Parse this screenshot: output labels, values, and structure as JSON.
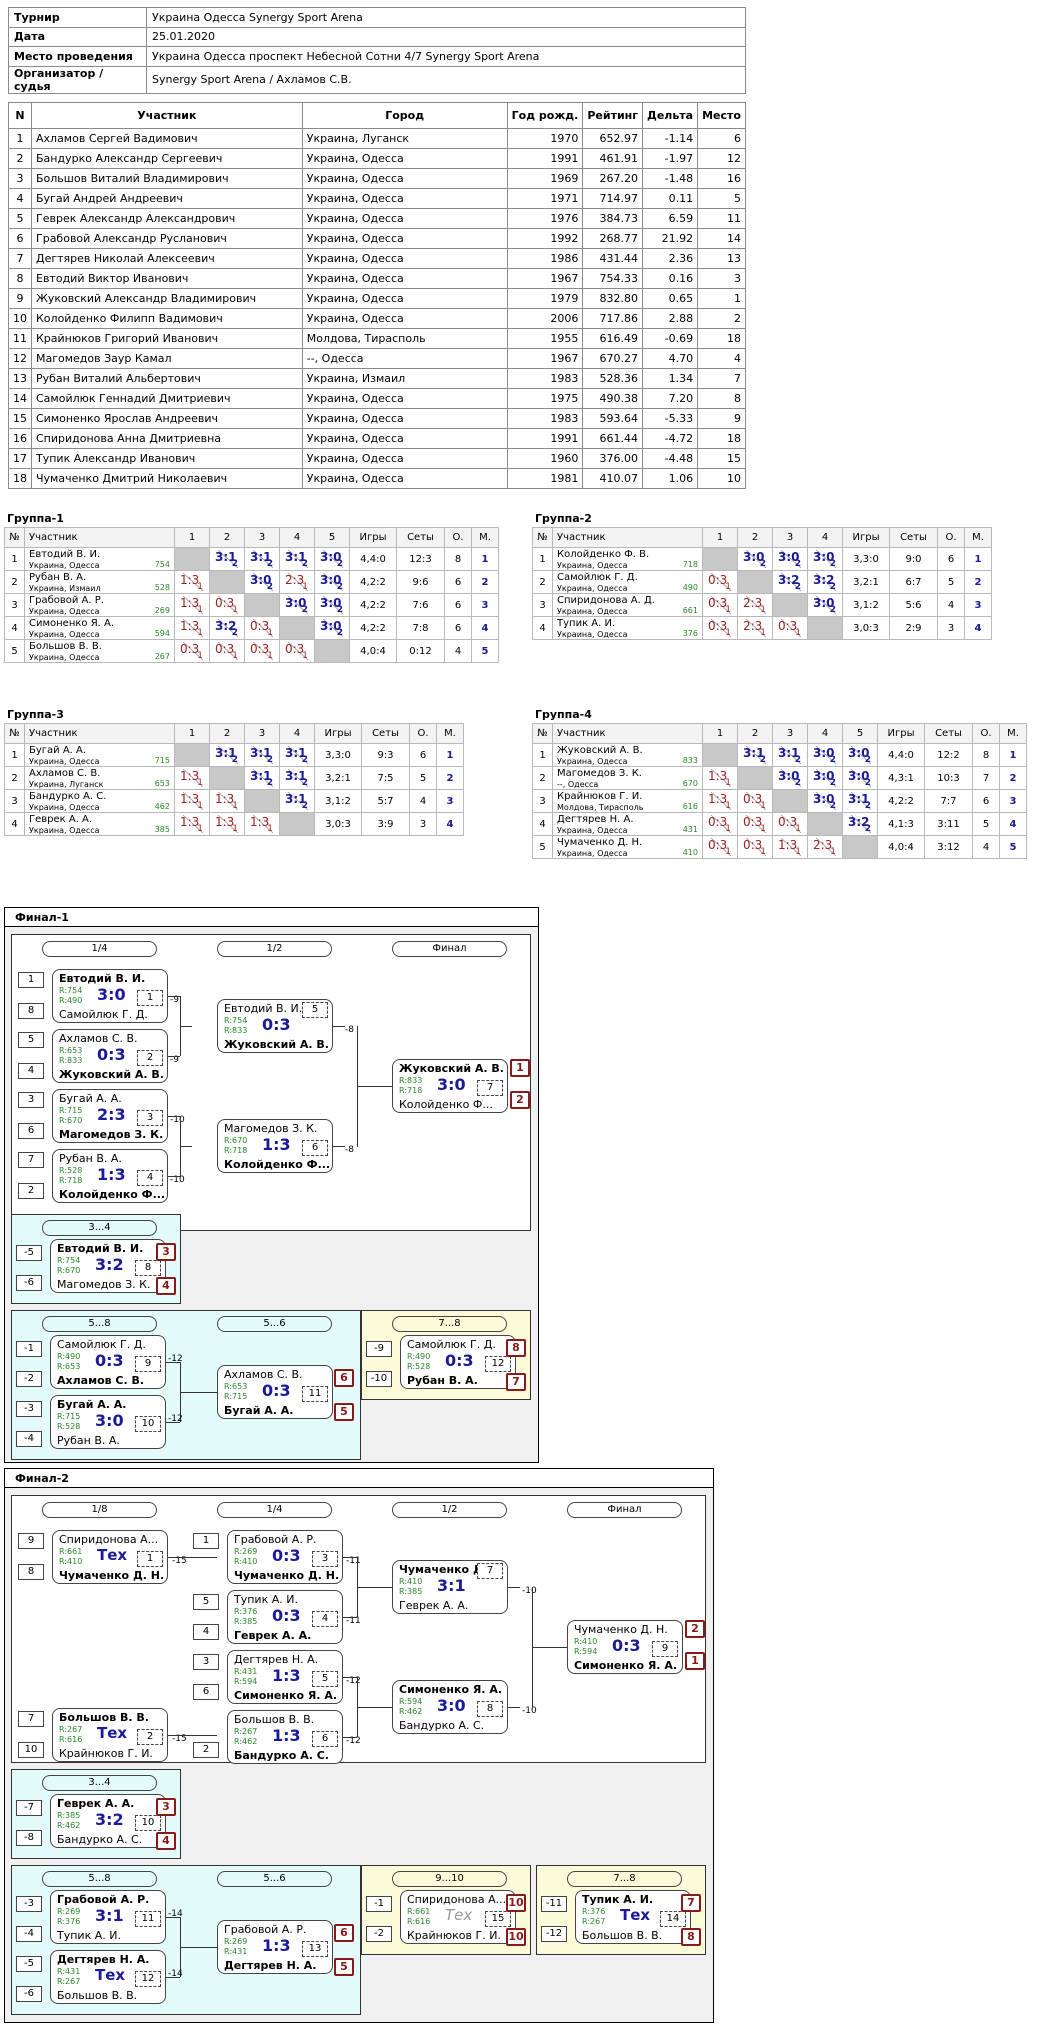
{
  "info": [
    {
      "k": "Турнир",
      "v": "Украина Одесса Synergy Sport Arena"
    },
    {
      "k": "Дата",
      "v": "25.01.2020"
    },
    {
      "k": "Место проведения",
      "v": "Украина Одесса проспект Небесной Сотни 4/7 Synergy Sport Arena"
    },
    {
      "k": "Организатор / судья",
      "v": "Synergy Sport Arena / Ахламов С.В."
    }
  ],
  "players_head": [
    "N",
    "Участник",
    "Город",
    "Год рожд.",
    "Рейтинг",
    "Дельта",
    "Место"
  ],
  "players": [
    [
      "1",
      "Ахламов Сергей Вадимович",
      "Украина, Луганск",
      "1970",
      "652.97",
      "-1.14",
      "6"
    ],
    [
      "2",
      "Бандурко Александр Сергеевич",
      "Украина, Одесса",
      "1991",
      "461.91",
      "-1.97",
      "12"
    ],
    [
      "3",
      "Большов Виталий Владимирович",
      "Украина, Одесса",
      "1969",
      "267.20",
      "-1.48",
      "16"
    ],
    [
      "4",
      "Бугай Андрей Андреевич",
      "Украина, Одесса",
      "1971",
      "714.97",
      "0.11",
      "5"
    ],
    [
      "5",
      "Геврек Александр Александрович",
      "Украина, Одесса",
      "1976",
      "384.73",
      "6.59",
      "11"
    ],
    [
      "6",
      "Грабовой Александр Русланович",
      "Украина, Одесса",
      "1992",
      "268.77",
      "21.92",
      "14"
    ],
    [
      "7",
      "Дегтярев Николай Алексеевич",
      "Украина, Одесса",
      "1986",
      "431.44",
      "2.36",
      "13"
    ],
    [
      "8",
      "Евтодий Виктор Иванович",
      "Украина, Одесса",
      "1967",
      "754.33",
      "0.16",
      "3"
    ],
    [
      "9",
      "Жуковский Александр Владимирович",
      "Украина, Одесса",
      "1979",
      "832.80",
      "0.65",
      "1"
    ],
    [
      "10",
      "Колойденко Филипп Вадимович",
      "Украина, Одесса",
      "2006",
      "717.86",
      "2.88",
      "2"
    ],
    [
      "11",
      "Крайнюков Григорий Иванович",
      "Молдова, Тирасполь",
      "1955",
      "616.49",
      "-0.69",
      "18"
    ],
    [
      "12",
      "Магомедов Заур Камал",
      "--, Одесса",
      "1967",
      "670.27",
      "4.70",
      "4"
    ],
    [
      "13",
      "Рубан Виталий Альбертович",
      "Украина, Измаил",
      "1983",
      "528.36",
      "1.34",
      "7"
    ],
    [
      "14",
      "Самойлюк Геннадий Дмитриевич",
      "Украина, Одесса",
      "1975",
      "490.38",
      "7.20",
      "8"
    ],
    [
      "15",
      "Симоненко Ярослав Андреевич",
      "Украина, Одесса",
      "1983",
      "593.64",
      "-5.33",
      "9"
    ],
    [
      "16",
      "Спиридонова Анна Дмитриевна",
      "Украина, Одесса",
      "1991",
      "661.44",
      "-4.72",
      "18"
    ],
    [
      "17",
      "Тупик Александр Иванович",
      "Украина, Одесса",
      "1960",
      "376.00",
      "-4.48",
      "15"
    ],
    [
      "18",
      "Чумаченко Дмитрий Николаевич",
      "Украина, Одесса",
      "1981",
      "410.07",
      "1.06",
      "10"
    ]
  ],
  "group_head": {
    "n": "№",
    "name": "Участник",
    "games": "Игры",
    "sets": "Сеты",
    "o": "О.",
    "m": "М."
  },
  "groups": [
    {
      "title": "Группа-1",
      "rows": [
        {
          "n": "1",
          "name": "Евтодий В. И.",
          "city": "Украина, Одесса",
          "r": "754",
          "cells": [
            "X",
            "3:1 2",
            "3:1 2",
            "3:1 2",
            "3:0 2"
          ],
          "games": "4,4:0",
          "sets": "12:3",
          "o": "8",
          "m": "1"
        },
        {
          "n": "2",
          "name": "Рубан В. А.",
          "city": "Украина, Измаил",
          "r": "528",
          "cells": [
            "1:3 1",
            "X",
            "3:0 2",
            "2:3 1",
            "3:0 2"
          ],
          "games": "4,2:2",
          "sets": "9:6",
          "o": "6",
          "m": "2"
        },
        {
          "n": "3",
          "name": "Грабовой А. Р.",
          "city": "Украина, Одесса",
          "r": "269",
          "cells": [
            "1:3 1",
            "0:3 1",
            "X",
            "3:0 2",
            "3:0 2"
          ],
          "games": "4,2:2",
          "sets": "7:6",
          "o": "6",
          "m": "3"
        },
        {
          "n": "4",
          "name": "Симоненко Я. А.",
          "city": "Украина, Одесса",
          "r": "594",
          "cells": [
            "1:3 1",
            "3:2 2",
            "0:3 1",
            "X",
            "3:0 2"
          ],
          "games": "4,2:2",
          "sets": "7:8",
          "o": "6",
          "m": "4"
        },
        {
          "n": "5",
          "name": "Большов В. В.",
          "city": "Украина, Одесса",
          "r": "267",
          "cells": [
            "0:3 1",
            "0:3 1",
            "0:3 1",
            "0:3 1",
            "X"
          ],
          "games": "4,0:4",
          "sets": "0:12",
          "o": "4",
          "m": "5"
        }
      ]
    },
    {
      "title": "Группа-2",
      "rows": [
        {
          "n": "1",
          "name": "Колойденко Ф. В.",
          "city": "Украина, Одесса",
          "r": "718",
          "cells": [
            "X",
            "3:0 2",
            "3:0 2",
            "3:0 2"
          ],
          "games": "3,3:0",
          "sets": "9:0",
          "o": "6",
          "m": "1"
        },
        {
          "n": "2",
          "name": "Самойлюк Г. Д.",
          "city": "Украина, Одесса",
          "r": "490",
          "cells": [
            "0:3 1",
            "X",
            "3:2 2",
            "3:2 2"
          ],
          "games": "3,2:1",
          "sets": "6:7",
          "o": "5",
          "m": "2"
        },
        {
          "n": "3",
          "name": "Спиридонова А. Д.",
          "city": "Украина, Одесса",
          "r": "661",
          "cells": [
            "0:3 1",
            "2:3 1",
            "X",
            "3:0 2"
          ],
          "games": "3,1:2",
          "sets": "5:6",
          "o": "4",
          "m": "3"
        },
        {
          "n": "4",
          "name": "Тупик А. И.",
          "city": "Украина, Одесса",
          "r": "376",
          "cells": [
            "0:3 1",
            "2:3 1",
            "0:3 1",
            "X"
          ],
          "games": "3,0:3",
          "sets": "2:9",
          "o": "3",
          "m": "4"
        }
      ]
    },
    {
      "title": "Группа-3",
      "rows": [
        {
          "n": "1",
          "name": "Бугай А. А.",
          "city": "Украина, Одесса",
          "r": "715",
          "cells": [
            "X",
            "3:1 2",
            "3:1 2",
            "3:1 2"
          ],
          "games": "3,3:0",
          "sets": "9:3",
          "o": "6",
          "m": "1"
        },
        {
          "n": "2",
          "name": "Ахламов С. В.",
          "city": "Украина, Луганск",
          "r": "653",
          "cells": [
            "1:3 1",
            "X",
            "3:1 2",
            "3:1 2"
          ],
          "games": "3,2:1",
          "sets": "7:5",
          "o": "5",
          "m": "2"
        },
        {
          "n": "3",
          "name": "Бандурко А. С.",
          "city": "Украина, Одесса",
          "r": "462",
          "cells": [
            "1:3 1",
            "1:3 1",
            "X",
            "3:1 2"
          ],
          "games": "3,1:2",
          "sets": "5:7",
          "o": "4",
          "m": "3"
        },
        {
          "n": "4",
          "name": "Геврек А. А.",
          "city": "Украина, Одесса",
          "r": "385",
          "cells": [
            "1:3 1",
            "1:3 1",
            "1:3 1",
            "X"
          ],
          "games": "3,0:3",
          "sets": "3:9",
          "o": "3",
          "m": "4"
        }
      ]
    },
    {
      "title": "Группа-4",
      "rows": [
        {
          "n": "1",
          "name": "Жуковский А. В.",
          "city": "Украина, Одесса",
          "r": "833",
          "cells": [
            "X",
            "3:1 2",
            "3:1 2",
            "3:0 2",
            "3:0 2"
          ],
          "games": "4,4:0",
          "sets": "12:2",
          "o": "8",
          "m": "1"
        },
        {
          "n": "2",
          "name": "Магомедов З. К.",
          "city": "--, Одесса",
          "r": "670",
          "cells": [
            "1:3 1",
            "X",
            "3:0 2",
            "3:0 2",
            "3:0 2"
          ],
          "games": "4,3:1",
          "sets": "10:3",
          "o": "7",
          "m": "2"
        },
        {
          "n": "3",
          "name": "Крайнюков Г. И.",
          "city": "Молдова, Тирасполь",
          "r": "616",
          "cells": [
            "1:3 1",
            "0:3 1",
            "X",
            "3:0 2",
            "3:1 2"
          ],
          "games": "4,2:2",
          "sets": "7:7",
          "o": "6",
          "m": "3"
        },
        {
          "n": "4",
          "name": "Дегтярев Н. А.",
          "city": "Украина, Одесса",
          "r": "431",
          "cells": [
            "0:3 1",
            "0:3 1",
            "0:3 1",
            "X",
            "3:2 2"
          ],
          "games": "4,1:3",
          "sets": "3:11",
          "o": "5",
          "m": "4"
        },
        {
          "n": "5",
          "name": "Чумаченко Д. Н.",
          "city": "Украина, Одесса",
          "r": "410",
          "cells": [
            "0:3 1",
            "0:3 1",
            "1:3 1",
            "2:3 1",
            "X"
          ],
          "games": "4,0:4",
          "sets": "3:12",
          "o": "4",
          "m": "5"
        }
      ]
    }
  ],
  "final1": {
    "title": "Финал-1",
    "stages": [
      "1/4",
      "1/2",
      "Финал"
    ],
    "p34": "3...4",
    "p58": "5...8",
    "p56": "5...6",
    "p78": "7...8",
    "seeds": [
      "1",
      "8",
      "5",
      "4",
      "3",
      "6",
      "7",
      "2"
    ],
    "m": [
      {
        "p1": "Евтодий В. И.",
        "r1": "R:754",
        "sc": "3:0",
        "r2": "R:490",
        "p2": "Самойлюк Г. Д.",
        "n": "1",
        "w": 1
      },
      {
        "p1": "Ахламов С. В.",
        "r1": "R:653",
        "sc": "0:3",
        "r2": "R:833",
        "p2": "Жуковский А. В.",
        "n": "2",
        "w": 2
      },
      {
        "p1": "Бугай А. А.",
        "r1": "R:715",
        "sc": "2:3",
        "r2": "R:670",
        "p2": "Магомедов З. К.",
        "n": "3",
        "w": 2
      },
      {
        "p1": "Рубан В. А.",
        "r1": "R:528",
        "sc": "1:3",
        "r2": "R:718",
        "p2": "Колойденко Ф...",
        "n": "4",
        "w": 2
      },
      {
        "p1": "Евтодий В. И.",
        "r1": "R:754",
        "sc": "0:3",
        "r2": "R:833",
        "p2": "Жуковский А. В.",
        "n": "5",
        "w": 2
      },
      {
        "p1": "Магомедов З. К.",
        "r1": "R:670",
        "sc": "1:3",
        "r2": "R:718",
        "p2": "Колойденко Ф...",
        "n": "6",
        "w": 2
      },
      {
        "p1": "Жуковский А. В.",
        "r1": "R:833",
        "sc": "3:0",
        "r2": "R:718",
        "p2": "Колойденко Ф...",
        "n": "7",
        "w": 1
      },
      {
        "p1": "Евтодий В. И.",
        "r1": "R:754",
        "sc": "3:2",
        "r2": "R:670",
        "p2": "Магомедов З. К.",
        "n": "8",
        "w": 1
      },
      {
        "p1": "Самойлюк Г. Д.",
        "r1": "R:490",
        "sc": "0:3",
        "r2": "R:653",
        "p2": "Ахламов С. В.",
        "n": "9",
        "w": 2
      },
      {
        "p1": "Бугай А. А.",
        "r1": "R:715",
        "sc": "3:0",
        "r2": "R:528",
        "p2": "Рубан В. А.",
        "n": "10",
        "w": 1
      },
      {
        "p1": "Ахламов С. В.",
        "r1": "R:653",
        "sc": "0:3",
        "r2": "R:715",
        "p2": "Бугай А. А.",
        "n": "11",
        "w": 2
      },
      {
        "p1": "Самойлюк Г. Д.",
        "r1": "R:490",
        "sc": "0:3",
        "r2": "R:528",
        "p2": "Рубан В. А.",
        "n": "12",
        "w": 2
      }
    ],
    "refs": [
      "-9",
      "-9",
      "-10",
      "-10",
      "-8",
      "-8",
      "-5",
      "-6",
      "-1",
      "-2",
      "-3",
      "-4",
      "-12",
      "-12",
      "-9",
      "-10"
    ],
    "places": [
      "1",
      "2",
      "3",
      "4",
      "6",
      "5",
      "8",
      "7"
    ]
  },
  "final2": {
    "title": "Финал-2",
    "stages": [
      "1/8",
      "1/4",
      "1/2",
      "Финал"
    ],
    "p34": "3...4",
    "p58": "5...8",
    "p56": "5...6",
    "p910": "9...10",
    "p78": "7...8",
    "seeds": [
      "9",
      "8",
      "1",
      "5",
      "4",
      "3",
      "6",
      "7",
      "10",
      "2"
    ],
    "m": [
      {
        "p1": "Спиридонова А...",
        "r1": "R:661",
        "sc": "Тех",
        "r2": "R:410",
        "p2": "Чумаченко Д. Н.",
        "n": "1",
        "w": 2
      },
      {
        "p1": "Большов В. В.",
        "r1": "R:267",
        "sc": "Тех",
        "r2": "R:616",
        "p2": "Крайнюков Г. И.",
        "n": "2",
        "w": 1
      },
      {
        "p1": "Грабовой А. Р.",
        "r1": "R:269",
        "sc": "0:3",
        "r2": "R:410",
        "p2": "Чумаченко Д. Н.",
        "n": "3",
        "w": 2
      },
      {
        "p1": "Тупик А. И.",
        "r1": "R:376",
        "sc": "0:3",
        "r2": "R:385",
        "p2": "Геврек А. А.",
        "n": "4",
        "w": 2
      },
      {
        "p1": "Дегтярев Н. А.",
        "r1": "R:431",
        "sc": "1:3",
        "r2": "R:594",
        "p2": "Симоненко Я. А.",
        "n": "5",
        "w": 2
      },
      {
        "p1": "Большов В. В.",
        "r1": "R:267",
        "sc": "1:3",
        "r2": "R:462",
        "p2": "Бандурко А. С.",
        "n": "6",
        "w": 2
      },
      {
        "p1": "Чумаченко Д. Н.",
        "r1": "R:410",
        "sc": "3:1",
        "r2": "R:385",
        "p2": "Геврек А. А.",
        "n": "7",
        "w": 1
      },
      {
        "p1": "Симоненко Я. А.",
        "r1": "R:594",
        "sc": "3:0",
        "r2": "R:462",
        "p2": "Бандурко А. С.",
        "n": "8",
        "w": 1
      },
      {
        "p1": "Чумаченко Д. Н.",
        "r1": "R:410",
        "sc": "0:3",
        "r2": "R:594",
        "p2": "Симоненко Я. А.",
        "n": "9",
        "w": 2
      },
      {
        "p1": "Геврек А. А.",
        "r1": "R:385",
        "sc": "3:2",
        "r2": "R:462",
        "p2": "Бандурко А. С.",
        "n": "10",
        "w": 1
      },
      {
        "p1": "Грабовой А. Р.",
        "r1": "R:269",
        "sc": "3:1",
        "r2": "R:376",
        "p2": "Тупик А. И.",
        "n": "11",
        "w": 1
      },
      {
        "p1": "Дегтярев Н. А.",
        "r1": "R:431",
        "sc": "Тех",
        "r2": "R:267",
        "p2": "Большов В. В.",
        "n": "12",
        "w": 1
      },
      {
        "p1": "Грабовой А. Р.",
        "r1": "R:269",
        "sc": "1:3",
        "r2": "R:431",
        "p2": "Дегтярев Н. А.",
        "n": "13",
        "w": 2
      },
      {
        "p1": "Тупик А. И.",
        "r1": "R:376",
        "sc": "Тех",
        "r2": "R:267",
        "p2": "Большов В. В.",
        "n": "14",
        "w": 1
      },
      {
        "p1": "Спиридонова А...",
        "r1": "R:661",
        "sc": "Тех",
        "r2": "R:616",
        "p2": "Крайнюков Г. И.",
        "n": "15",
        "w": 0
      }
    ],
    "refs": [
      "-15",
      "-15",
      "-11",
      "-11",
      "-12",
      "-12",
      "-10",
      "-10",
      "-7",
      "-8",
      "-3",
      "-4",
      "-5",
      "-6",
      "-14",
      "-14",
      "-1",
      "-2",
      "-11",
      "-12"
    ],
    "places": [
      "2",
      "1",
      "3",
      "4",
      "6",
      "5",
      "10",
      "10",
      "7",
      "8"
    ]
  }
}
